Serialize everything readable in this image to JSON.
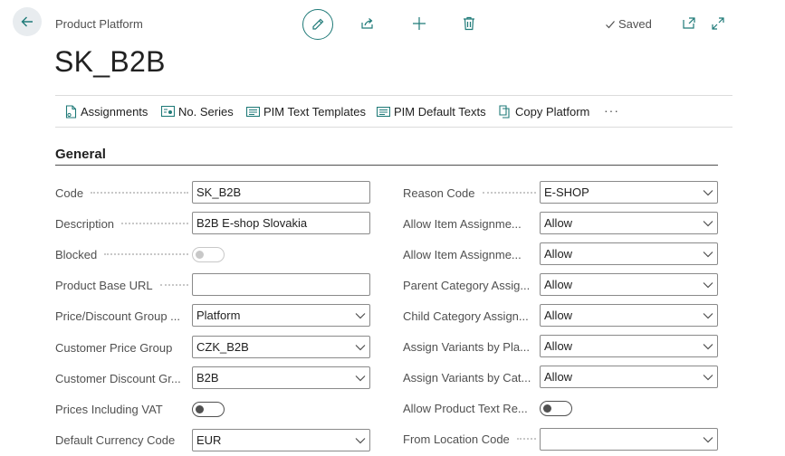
{
  "header": {
    "caption": "Product Platform",
    "title": "SK_B2B",
    "saved_label": "Saved"
  },
  "actions": [
    {
      "label": "Assignments",
      "icon": "document-icon"
    },
    {
      "label": "No. Series",
      "icon": "number-series-icon"
    },
    {
      "label": "PIM Text Templates",
      "icon": "text-template-icon"
    },
    {
      "label": "PIM Default Texts",
      "icon": "default-text-icon"
    },
    {
      "label": "Copy Platform",
      "icon": "copy-icon"
    }
  ],
  "more_label": "···",
  "section": {
    "title": "General"
  },
  "left_fields": [
    {
      "label": "Code",
      "value": "SK_B2B",
      "type": "text"
    },
    {
      "label": "Description",
      "value": "B2B E-shop Slovakia",
      "type": "text"
    },
    {
      "label": "Blocked",
      "value": "off",
      "type": "toggle-disabled"
    },
    {
      "label": "Product Base URL",
      "value": "",
      "type": "text"
    },
    {
      "label": "Price/Discount Group ...",
      "value": "Platform",
      "type": "select"
    },
    {
      "label": "Customer Price Group",
      "value": "CZK_B2B",
      "type": "select"
    },
    {
      "label": "Customer Discount Gr...",
      "value": "B2B",
      "type": "select"
    },
    {
      "label": "Prices Including VAT",
      "value": "off",
      "type": "toggle"
    },
    {
      "label": "Default Currency Code",
      "value": "EUR",
      "type": "select"
    }
  ],
  "right_fields": [
    {
      "label": "Reason Code",
      "value": "E-SHOP",
      "type": "select"
    },
    {
      "label": "Allow Item Assignme...",
      "value": "Allow",
      "type": "select"
    },
    {
      "label": "Allow Item Assignme...",
      "value": "Allow",
      "type": "select"
    },
    {
      "label": "Parent Category Assig...",
      "value": "Allow",
      "type": "select"
    },
    {
      "label": "Child Category Assign...",
      "value": "Allow",
      "type": "select"
    },
    {
      "label": "Assign Variants by Pla...",
      "value": "Allow",
      "type": "select"
    },
    {
      "label": "Assign Variants by Cat...",
      "value": "Allow",
      "type": "select"
    },
    {
      "label": "Allow Product Text Re...",
      "value": "off",
      "type": "toggle"
    },
    {
      "label": "From Location Code",
      "value": "",
      "type": "select"
    }
  ],
  "colors": {
    "accent": "#1f7a78",
    "label": "#505050",
    "border": "#8a8a8a"
  }
}
